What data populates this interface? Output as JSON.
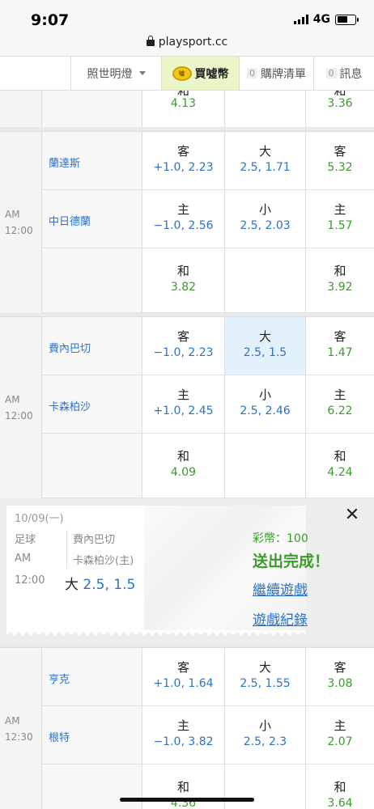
{
  "status": {
    "time": "9:07",
    "network": "4G"
  },
  "browser": {
    "url": "playsport.cc"
  },
  "nav": {
    "item1": "照世明燈",
    "item2": "買噓幣",
    "coin_text": "噓",
    "item3_count": "0",
    "item3": "購牌清單",
    "item4_count": "0",
    "item4": "訊息"
  },
  "top_fragment": {
    "c1_value": "4.13",
    "c3_value": "3.36"
  },
  "games": [
    {
      "am": "AM",
      "time": "12:00",
      "rows": [
        {
          "team": "蘭達斯",
          "c1_label": "客",
          "c1_value": "+1.0, 2.23",
          "c2_label": "大",
          "c2_value": "2.5, 1.71",
          "c3_label": "客",
          "c3_value": "5.32"
        },
        {
          "team": "中日德蘭",
          "c1_label": "主",
          "c1_value": "−1.0, 2.56",
          "c2_label": "小",
          "c2_value": "2.5, 2.03",
          "c3_label": "主",
          "c3_value": "1.57"
        },
        {
          "team": "",
          "c1_label": "和",
          "c1_value": "3.82",
          "c2_label": "",
          "c2_value": "",
          "c3_label": "和",
          "c3_value": "3.92"
        }
      ]
    },
    {
      "am": "AM",
      "time": "12:00",
      "rows": [
        {
          "team": "費內巴切",
          "c1_label": "客",
          "c1_value": "−1.0, 2.23",
          "c2_label": "大",
          "c2_value": "2.5, 1.5",
          "c3_label": "客",
          "c3_value": "1.47"
        },
        {
          "team": "卡森柏沙",
          "c1_label": "主",
          "c1_value": "+1.0, 2.45",
          "c2_label": "小",
          "c2_value": "2.5, 2.46",
          "c3_label": "主",
          "c3_value": "6.22"
        },
        {
          "team": "",
          "c1_label": "和",
          "c1_value": "4.09",
          "c2_label": "",
          "c2_value": "",
          "c3_label": "和",
          "c3_value": "4.24"
        }
      ]
    },
    {
      "am": "AM",
      "time": "12:30",
      "rows": [
        {
          "team": "亨克",
          "c1_label": "客",
          "c1_value": "+1.0, 1.64",
          "c2_label": "大",
          "c2_value": "2.5, 1.55",
          "c3_label": "客",
          "c3_value": "3.08"
        },
        {
          "team": "根特",
          "c1_label": "主",
          "c1_value": "−1.0, 3.82",
          "c2_label": "小",
          "c2_value": "2.5, 2.3",
          "c3_label": "主",
          "c3_value": "2.07"
        },
        {
          "team": "",
          "c1_label": "和",
          "c1_value": "4.36",
          "c2_label": "",
          "c2_value": "",
          "c3_label": "和",
          "c3_value": "3.64"
        }
      ]
    }
  ],
  "popup": {
    "date": "10/09(一)",
    "sport": "足球",
    "am": "AM",
    "time": "12:00",
    "team1": "費內巴切",
    "team2": "卡森柏沙(主)",
    "bet_label": "大",
    "bet_value": "2.5, 1.5",
    "coins": "彩幣：100",
    "done": "送出完成！",
    "link_continue": "繼續遊戲",
    "link_history": "遊戲紀錄",
    "close": "✕"
  }
}
